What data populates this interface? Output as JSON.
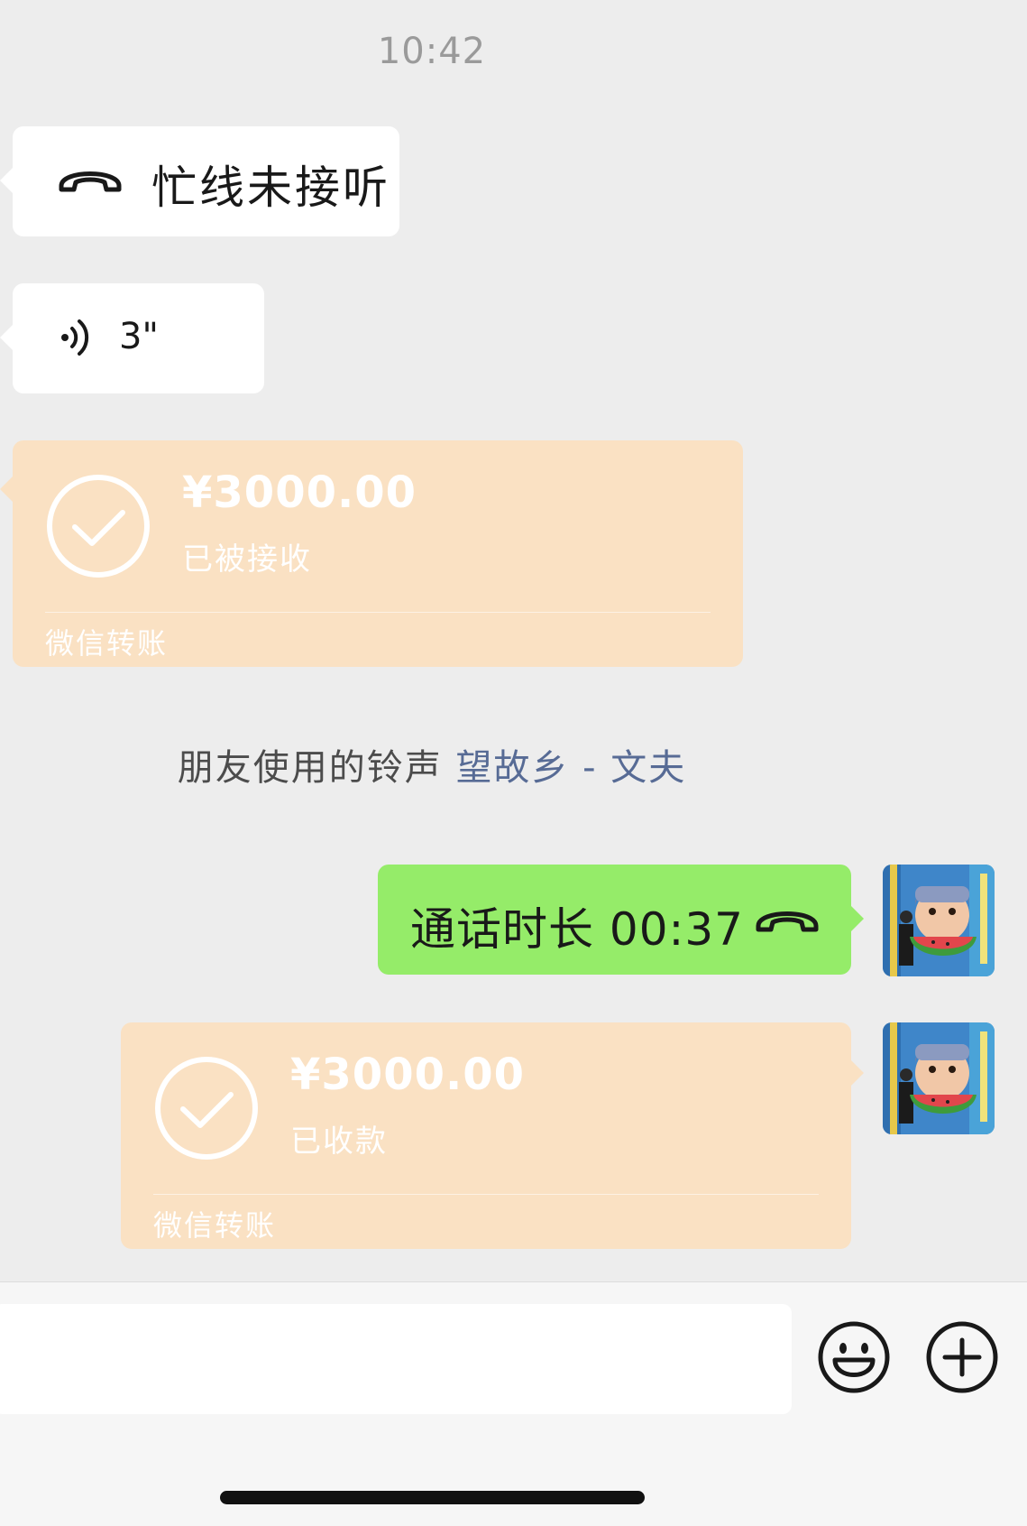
{
  "status": {
    "time": "10:42"
  },
  "messages": {
    "missed_call": {
      "text": "忙线未接听",
      "icon": "phone-hangup-icon"
    },
    "voice": {
      "duration": "3\"",
      "icon": "voice-wave-icon"
    },
    "transfer_received": {
      "amount": "¥3000.00",
      "status": "已被接收",
      "footer": "微信转账",
      "icon": "check-circle-icon"
    },
    "ringtone": {
      "prefix": "朋友使用的铃声",
      "song": "望故乡 - 文夫"
    },
    "call_duration": {
      "text": "通话时长 00:37",
      "icon": "phone-hangup-icon"
    },
    "transfer_accepted": {
      "amount": "¥3000.00",
      "status": "已收款",
      "footer": "微信转账",
      "icon": "check-circle-icon"
    }
  },
  "input_bar": {
    "placeholder": "",
    "emoji_icon": "emoji-icon",
    "plus_icon": "plus-circle-icon"
  },
  "colors": {
    "background": "#ededed",
    "bubble_white": "#ffffff",
    "bubble_green": "#95ec69",
    "transfer_peach": "#fae1c3",
    "link_blue": "#576b95"
  }
}
